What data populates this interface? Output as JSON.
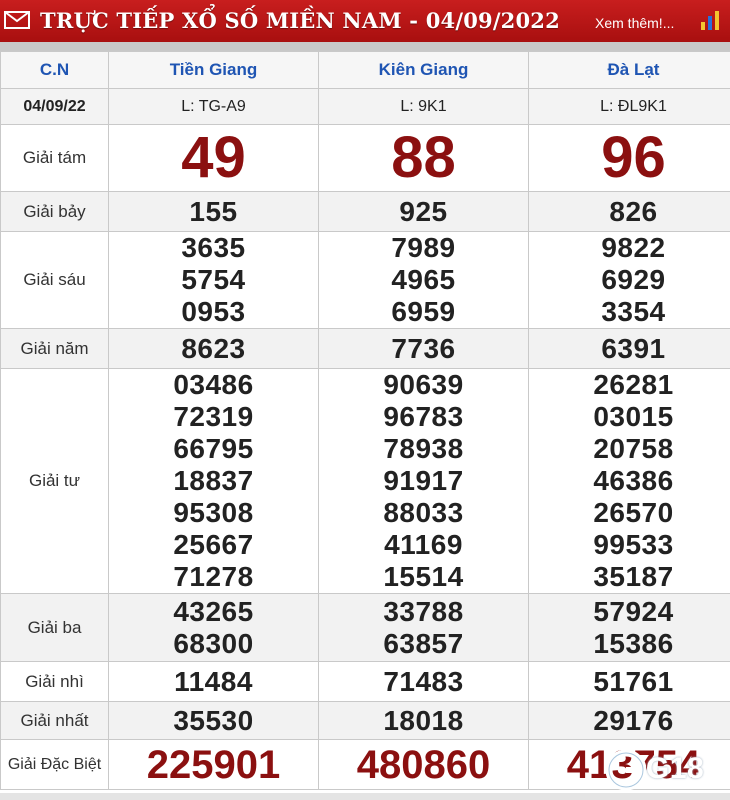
{
  "header": {
    "title": "TRỰC TIẾP XỔ SỐ MIỀN NAM - 04/09/2022",
    "more_link": "Xem thêm!...",
    "color": "#b81414"
  },
  "table": {
    "corner": "C.N",
    "date": "04/09/22",
    "provinces": [
      {
        "name": "Tiền Giang",
        "ticket": "L: TG-A9"
      },
      {
        "name": "Kiên Giang",
        "ticket": "L: 9K1"
      },
      {
        "name": "Đà Lạt",
        "ticket": "L: ĐL9K1"
      }
    ],
    "prizes": {
      "g8": {
        "label": "Giải tám",
        "values": [
          "49",
          "88",
          "96"
        ]
      },
      "g7": {
        "label": "Giải bảy",
        "values": [
          "155",
          "925",
          "826"
        ]
      },
      "g6": {
        "label": "Giải sáu",
        "values": [
          [
            "3635",
            "5754",
            "0953"
          ],
          [
            "7989",
            "4965",
            "6959"
          ],
          [
            "9822",
            "6929",
            "3354"
          ]
        ]
      },
      "g5": {
        "label": "Giải năm",
        "values": [
          "8623",
          "7736",
          "6391"
        ]
      },
      "g4": {
        "label": "Giải tư",
        "values": [
          [
            "03486",
            "72319",
            "66795",
            "18837",
            "95308",
            "25667",
            "71278"
          ],
          [
            "90639",
            "96783",
            "78938",
            "91917",
            "88033",
            "41169",
            "15514"
          ],
          [
            "26281",
            "03015",
            "20758",
            "46386",
            "26570",
            "99533",
            "35187"
          ]
        ]
      },
      "g3": {
        "label": "Giải ba",
        "values": [
          [
            "43265",
            "68300"
          ],
          [
            "33788",
            "63857"
          ],
          [
            "57924",
            "15386"
          ]
        ]
      },
      "g2": {
        "label": "Giải nhì",
        "values": [
          "11484",
          "71483",
          "51761"
        ]
      },
      "g1": {
        "label": "Giải nhất",
        "values": [
          "35530",
          "18018",
          "29176"
        ]
      },
      "db": {
        "label": "Giải Đặc Biệt",
        "values": [
          "225901",
          "480860",
          "413754"
        ]
      }
    }
  },
  "watermark": {
    "text": "G18"
  }
}
